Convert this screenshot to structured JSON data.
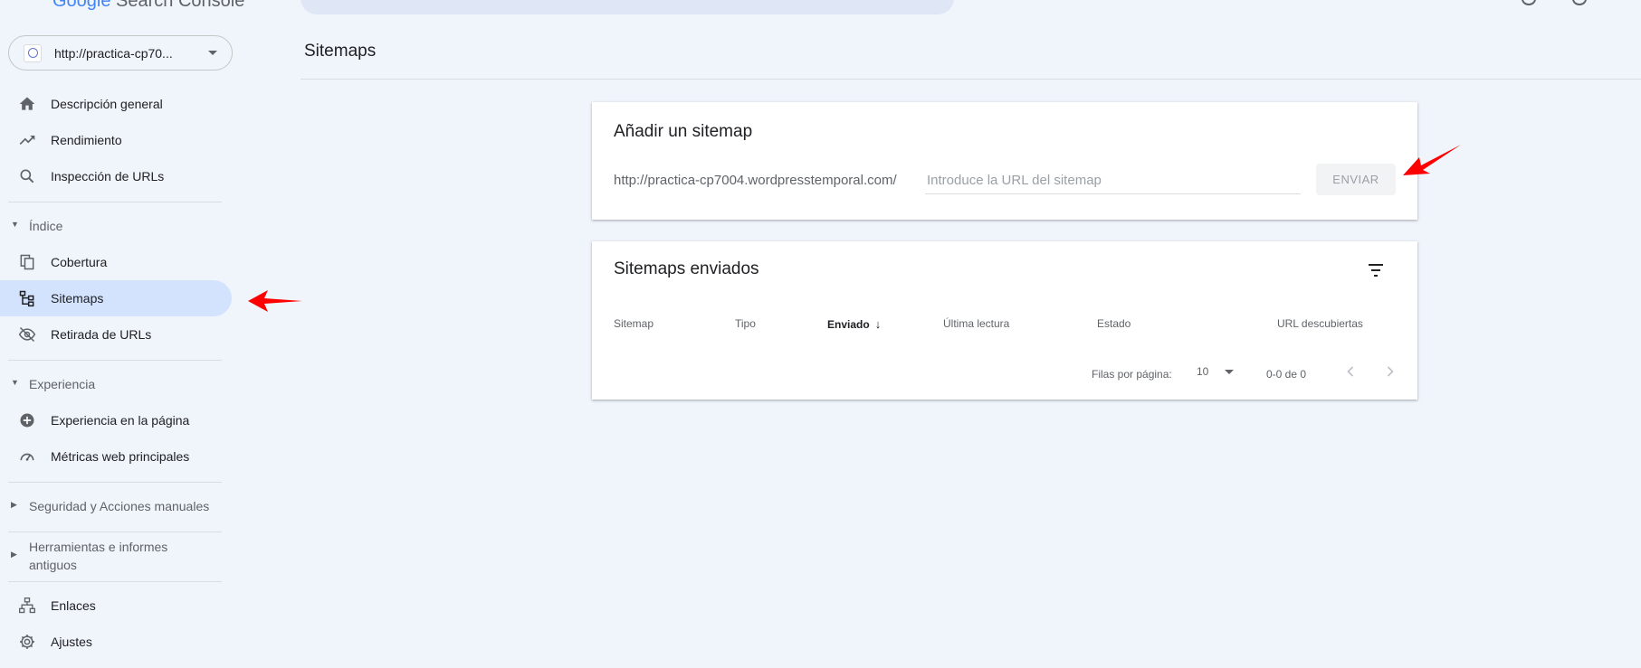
{
  "header": {
    "logo_g": "Google",
    "logo_rest": " Search Console"
  },
  "property": {
    "url": "http://practica-cp70..."
  },
  "sidebar": {
    "items": [
      {
        "label": "Descripción general",
        "icon": "home-icon"
      },
      {
        "label": "Rendimiento",
        "icon": "trending-up-icon"
      },
      {
        "label": "Inspección de URLs",
        "icon": "search-icon"
      }
    ],
    "section_index": {
      "label": "Índice"
    },
    "index_items": [
      {
        "label": "Cobertura",
        "icon": "copy-icon"
      },
      {
        "label": "Sitemaps",
        "icon": "sitemap-icon"
      },
      {
        "label": "Retirada de URLs",
        "icon": "eye-off-icon"
      }
    ],
    "section_experience": {
      "label": "Experiencia"
    },
    "experience_items": [
      {
        "label": "Experiencia en la página",
        "icon": "add-circle-icon"
      },
      {
        "label": "Métricas web principales",
        "icon": "speed-gauge-icon"
      }
    ],
    "section_security": {
      "label": "Seguridad y Acciones manuales"
    },
    "section_legacy": {
      "label_line1": "Herramientas e informes",
      "label_line2": "antiguos"
    },
    "bottom_items": [
      {
        "label": "Enlaces",
        "icon": "links-icon"
      },
      {
        "label": "Ajustes",
        "icon": "gear-icon"
      }
    ]
  },
  "main": {
    "page_title": "Sitemaps",
    "add_card": {
      "title": "Añadir un sitemap",
      "prefix": "http://practica-cp7004.wordpresstemporal.com/",
      "input_value": "",
      "input_placeholder": "Introduce la URL del sitemap",
      "submit_label": "ENVIAR"
    },
    "submitted_card": {
      "title": "Sitemaps enviados",
      "columns": [
        "Sitemap",
        "Tipo",
        "Enviado",
        "Última lectura",
        "Estado",
        "URL descubiertas"
      ],
      "rows_per_page_label": "Filas por página:",
      "rows_per_page_value": "10",
      "range_label": "0-0 de 0"
    }
  },
  "colors": {
    "background": "#f0f4fb",
    "active_nav": "#d3e3fd",
    "annotation_arrow": "#ff0000"
  }
}
